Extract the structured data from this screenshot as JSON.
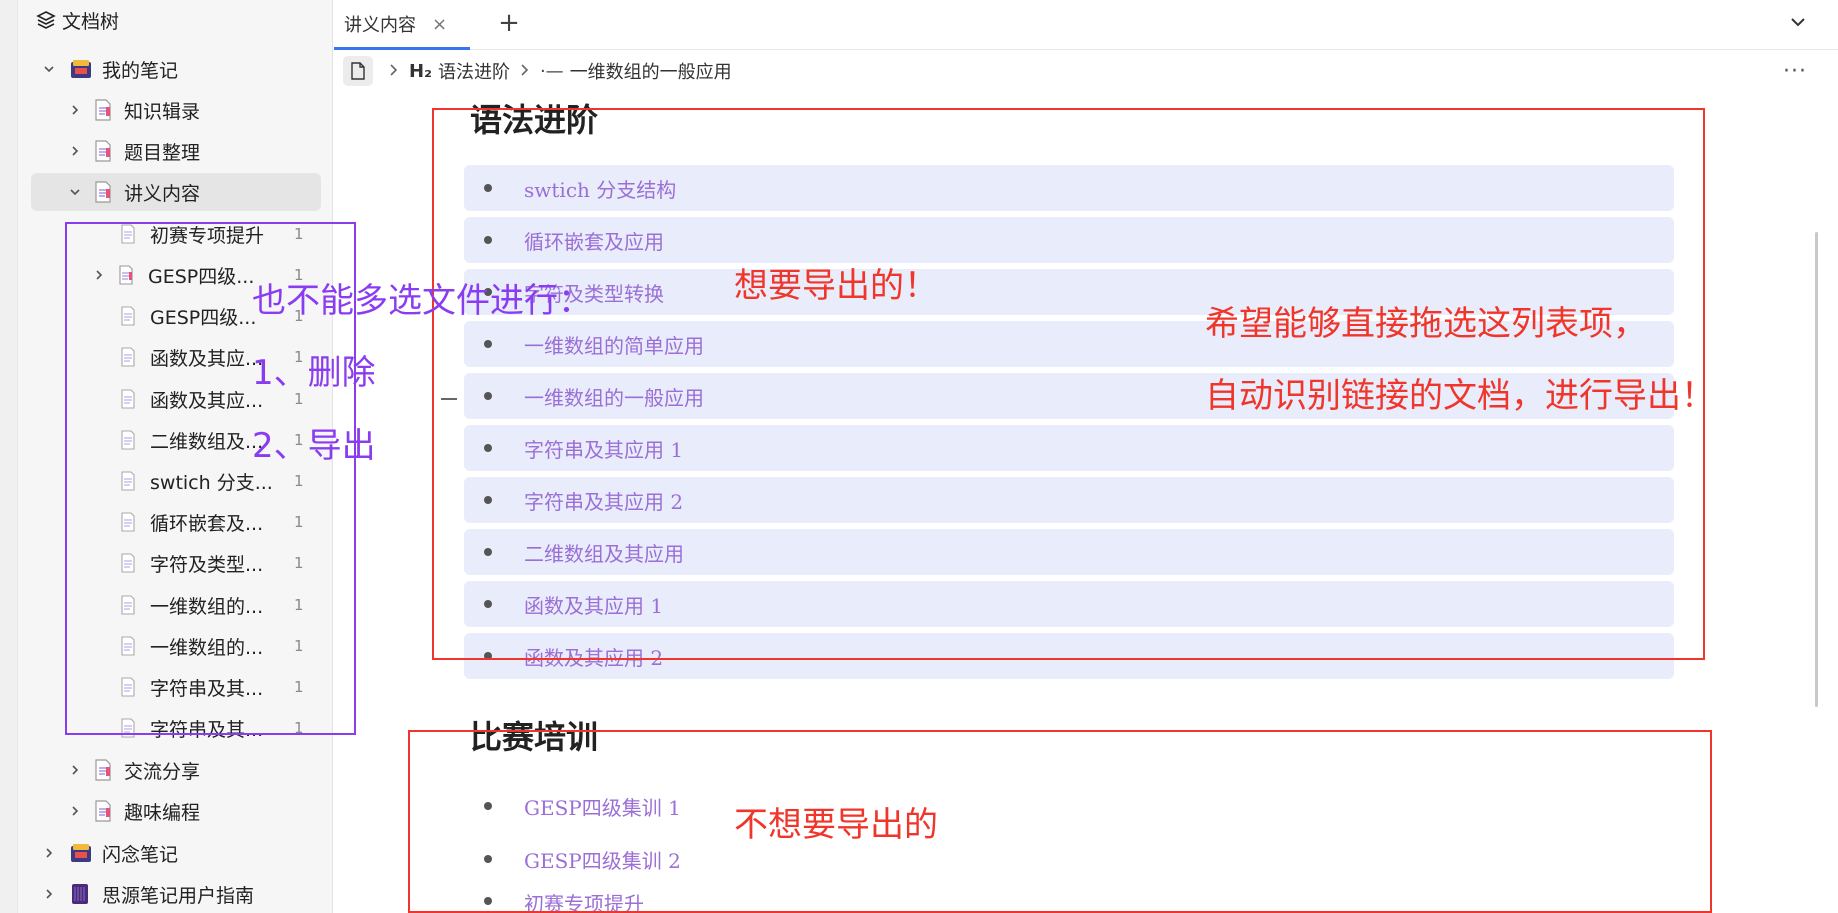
{
  "sidebar": {
    "title": "文档树",
    "notebook_my_notes": "我的笔记",
    "items": [
      {
        "label": "知识辑录"
      },
      {
        "label": "题目整理"
      },
      {
        "label": "讲义内容"
      }
    ],
    "children": [
      {
        "label": "初赛专项提升",
        "count": "1"
      },
      {
        "label": "GESP四级...",
        "count": "1"
      },
      {
        "label": "GESP四级...",
        "count": "1"
      },
      {
        "label": "函数及其应...",
        "count": "1"
      },
      {
        "label": "函数及其应...",
        "count": "1"
      },
      {
        "label": "二维数组及...",
        "count": "1"
      },
      {
        "label": "swtich 分支...",
        "count": "1"
      },
      {
        "label": "循环嵌套及...",
        "count": "1"
      },
      {
        "label": "字符及类型...",
        "count": "1"
      },
      {
        "label": "一维数组的...",
        "count": "1"
      },
      {
        "label": "一维数组的...",
        "count": "1"
      },
      {
        "label": "字符串及其...",
        "count": "1"
      },
      {
        "label": "字符串及其...",
        "count": "1"
      }
    ],
    "after_items": [
      {
        "label": "交流分享"
      },
      {
        "label": "趣味编程"
      }
    ],
    "notebooks": [
      {
        "label": "闪念笔记"
      },
      {
        "label": "思源笔记用户指南"
      }
    ]
  },
  "tabs": [
    {
      "label": "讲义内容",
      "close": "×"
    }
  ],
  "tab_add": "+",
  "breadcrumb": {
    "heading_prefix": "H₂",
    "heading": "语法进阶",
    "list_prefix": "·—",
    "item": "一维数组的一般应用"
  },
  "more_menu": "···",
  "content": {
    "section1": {
      "title": "语法进阶",
      "items": [
        "swtich 分支结构",
        "循环嵌套及应用",
        "字符及类型转换",
        "一维数组的简单应用",
        "一维数组的一般应用",
        "字符串及其应用 1",
        "字符串及其应用 2",
        "二维数组及其应用",
        "函数及其应用 1",
        "函数及其应用 2"
      ]
    },
    "section2": {
      "title": "比赛培训",
      "items": [
        "GESP四级集训 1",
        "GESP四级集训 2",
        "初赛专项提升"
      ]
    }
  },
  "annotations": {
    "multi_select": "也不能多选文件进行：",
    "delete": "1、删除",
    "export": "2、导出",
    "want_export": "想要导出的！",
    "hope_line1": "希望能够直接拖选这列表项，",
    "hope_line2": "自动识别链接的文档，进行导出！",
    "not_export": "不想要导出的",
    "colors": {
      "purple": "#8a3cf0",
      "red": "#f0352a"
    }
  }
}
